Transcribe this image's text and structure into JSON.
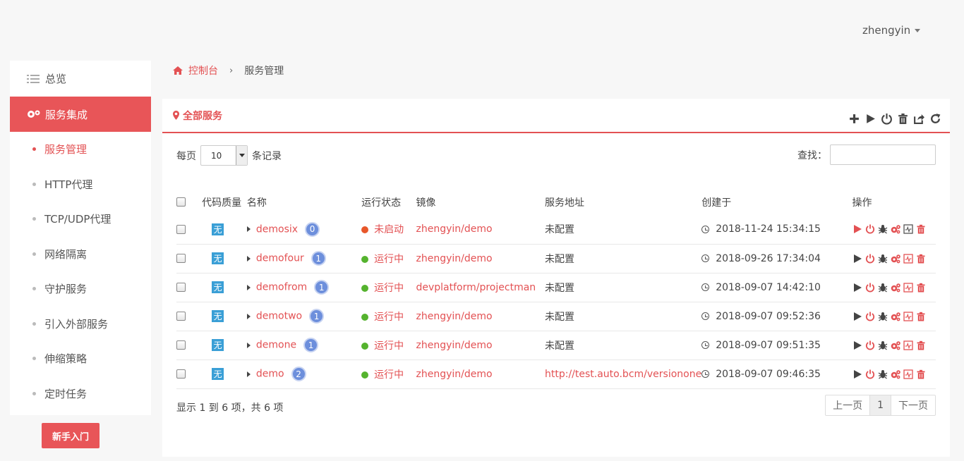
{
  "user": {
    "name": "zhengyin"
  },
  "sidebar": {
    "overview": "总览",
    "active_section": "服务集成",
    "items": [
      {
        "label": "服务管理",
        "current": true
      },
      {
        "label": "HTTP代理"
      },
      {
        "label": "TCP/UDP代理"
      },
      {
        "label": "网络隔离"
      },
      {
        "label": "守护服务"
      },
      {
        "label": "引入外部服务"
      },
      {
        "label": "伸缩策略"
      },
      {
        "label": "定时任务"
      }
    ],
    "newbie_button": "新手入门"
  },
  "breadcrumb": {
    "home": "控制台",
    "current": "服务管理"
  },
  "panel": {
    "title": "全部服务",
    "per_page_prefix": "每页",
    "per_page_value": "10",
    "per_page_suffix": "条记录",
    "search_label": "查找：",
    "columns": [
      "代码质量",
      "名称",
      "运行状态",
      "镜像",
      "服务地址",
      "创建于",
      "操作"
    ],
    "rows": [
      {
        "quality": "无",
        "name": "demosix",
        "count": "0",
        "status": "未启动",
        "status_color": "#e8572a",
        "image": "zhengyin/demo",
        "address": "未配置",
        "created": "2018-11-24 15:34:15"
      },
      {
        "quality": "无",
        "name": "demofour",
        "count": "1",
        "status": "运行中",
        "status_color": "#55b32e",
        "image": "zhengyin/demo",
        "address": "未配置",
        "created": "2018-09-26 17:34:04"
      },
      {
        "quality": "无",
        "name": "demofrom",
        "count": "1",
        "status": "运行中",
        "status_color": "#55b32e",
        "image": "devplatform/projectman",
        "address": "未配置",
        "created": "2018-09-07 14:42:10"
      },
      {
        "quality": "无",
        "name": "demotwo",
        "count": "1",
        "status": "运行中",
        "status_color": "#55b32e",
        "image": "zhengyin/demo",
        "address": "未配置",
        "created": "2018-09-07 09:52:36"
      },
      {
        "quality": "无",
        "name": "demone",
        "count": "1",
        "status": "运行中",
        "status_color": "#55b32e",
        "image": "zhengyin/demo",
        "address": "未配置",
        "created": "2018-09-07 09:51:35"
      },
      {
        "quality": "无",
        "name": "demo",
        "count": "2",
        "status": "运行中",
        "status_color": "#55b32e",
        "image": "zhengyin/demo",
        "address": "http://test.auto.bcm/versionone",
        "created": "2018-09-07 09:46:35"
      }
    ],
    "info": "显示 1 到 6 项，共 6 项",
    "pager": {
      "prev": "上一页",
      "page": "1",
      "next": "下一页"
    }
  },
  "colors": {
    "accent": "#e85558",
    "badge": "#6d8fdc",
    "running": "#55b32e",
    "stopped": "#e8572a"
  }
}
